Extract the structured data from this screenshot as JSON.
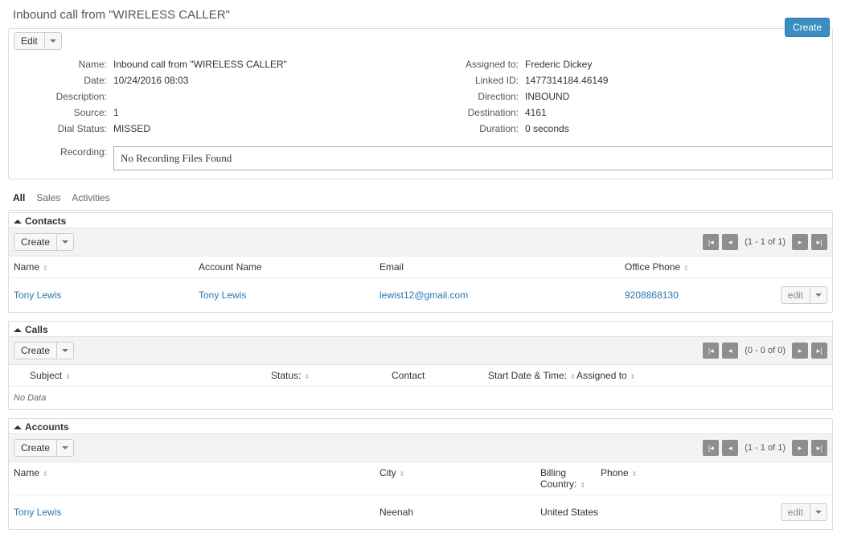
{
  "page_title": "Inbound call from \"WIRELESS CALLER\"",
  "create_label": "Create",
  "edit_label": "Edit",
  "detail": {
    "left": {
      "name_label": "Name:",
      "name": "Inbound call from \"WIRELESS CALLER\"",
      "date_label": "Date:",
      "date": "10/24/2016 08:03",
      "desc_label": "Description:",
      "desc": "",
      "source_label": "Source:",
      "source": "1",
      "dial_label": "Dial Status:",
      "dial": "MISSED",
      "rec_label": "Recording:",
      "rec_msg": "No Recording Files Found"
    },
    "right": {
      "assigned_label": "Assigned to:",
      "assigned": "Frederic Dickey",
      "linked_label": "Linked ID:",
      "linked": "1477314184.46149",
      "direction_label": "Direction:",
      "direction": "INBOUND",
      "dest_label": "Destination:",
      "dest": "4161",
      "dur_label": "Duration:",
      "dur": "0 seconds"
    }
  },
  "tabs": {
    "all": "All",
    "sales": "Sales",
    "activities": "Activities"
  },
  "contacts": {
    "title": "Contacts",
    "pager": "(1 - 1 of 1)",
    "cols": {
      "name": "Name",
      "account": "Account Name",
      "email": "Email",
      "phone": "Office Phone"
    },
    "row": {
      "name": "Tony Lewis",
      "account": "Tony Lewis",
      "email": "lewist12@gmail.com",
      "phone": "9208868130",
      "edit": "edit"
    }
  },
  "calls": {
    "title": "Calls",
    "pager": "(0 - 0 of 0)",
    "cols": {
      "subject": "Subject",
      "status": "Status:",
      "contact": "Contact",
      "start": "Start Date & Time:",
      "assigned": "Assigned to"
    },
    "no_data": "No Data"
  },
  "accounts": {
    "title": "Accounts",
    "pager": "(1 - 1 of 1)",
    "cols": {
      "name": "Name",
      "city": "City",
      "billing": "Billing Country:",
      "phone": "Phone"
    },
    "row": {
      "name": "Tony Lewis",
      "city": "Neenah",
      "billing": "United States",
      "phone": "",
      "edit": "edit"
    }
  },
  "btn": {
    "create_small": "Create"
  }
}
